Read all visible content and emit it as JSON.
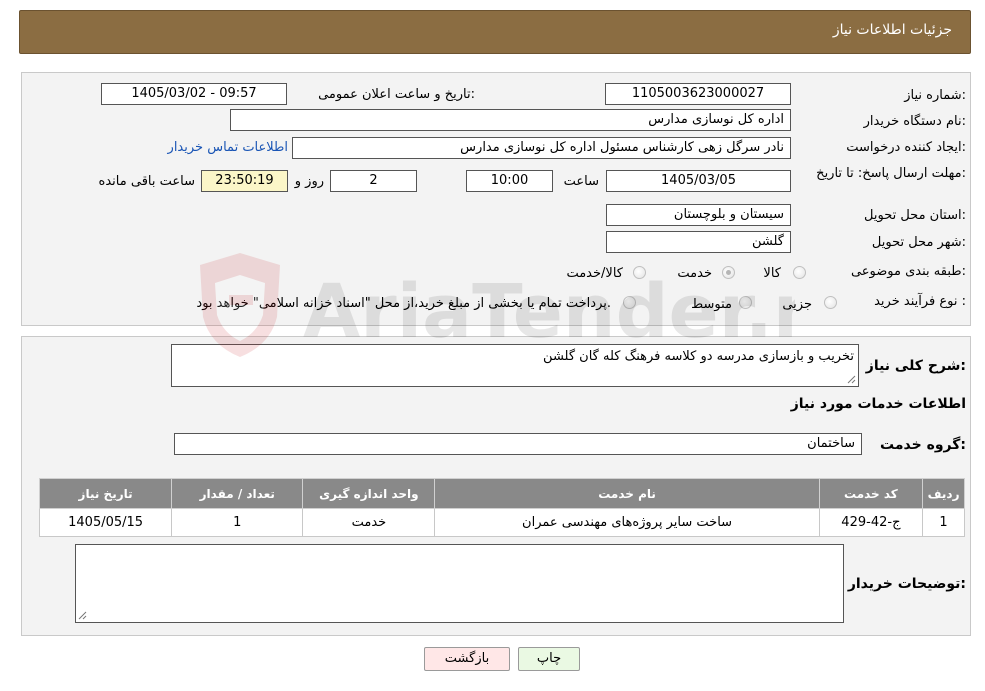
{
  "header": {
    "title": "جزئیات اطلاعات نیاز"
  },
  "form": {
    "need_number_label": "شماره نیاز:",
    "need_number": "1105003623000027",
    "announce_label": "تاریخ و ساعت اعلان عمومی:",
    "announce_value": "1405/03/02 - 09:57",
    "buyer_org_label": "نام دستگاه خریدار:",
    "buyer_org": "اداره کل نوسازی مدارس",
    "creator_label": "ایجاد کننده درخواست:",
    "creator": "نادر سرگل زهی کارشناس مسئول اداره کل نوسازی مدارس",
    "contact_link": "اطلاعات تماس خریدار",
    "deadline_label": "مهلت ارسال پاسخ: تا تاریخ:",
    "deadline_date": "1405/03/05",
    "hour_label": "ساعت",
    "deadline_time": "10:00",
    "days_value": "2",
    "days_label": "روز و",
    "remaining_time": "23:50:19",
    "remaining_label": "ساعت باقی مانده",
    "province_label": "استان محل تحویل:",
    "province": "سیستان و بلوچستان",
    "city_label": "شهر محل تحویل:",
    "city": "گلشن",
    "category_label": "طبقه بندی موضوعی:",
    "category_options": [
      "کالا",
      "خدمت",
      "کالا/خدمت"
    ],
    "category_selected_index": 1,
    "process_label": "نوع فرآیند خرید :",
    "process_options": [
      "جزیی",
      "متوسط"
    ],
    "process_note": "پرداخت تمام یا بخشی از مبلغ خرید،از محل \"اسناد خزانه اسلامی\" خواهد بود."
  },
  "details": {
    "summary_label": "شرح کلی نیاز:",
    "summary": "تخریب و بازسازی مدرسه دو کلاسه فرهنگ کله گان گلشن",
    "services_title": "اطلاعات خدمات مورد نیاز",
    "service_group_label": "گروه خدمت:",
    "service_group": "ساختمان",
    "table_headers": [
      "ردیف",
      "کد خدمت",
      "نام خدمت",
      "واحد اندازه گیری",
      "تعداد / مقدار",
      "تاریخ نیاز"
    ],
    "table_rows": [
      [
        "1",
        "ج-42-429",
        "ساخت سایر پروژه‌های مهندسی عمران",
        "خدمت",
        "1",
        "1405/05/15"
      ]
    ],
    "buyer_notes_label": "توضیحات خریدار:",
    "buyer_notes": ""
  },
  "buttons": {
    "print": "چاپ",
    "back": "بازگشت"
  },
  "watermark": {
    "text": "AriaTender.neT"
  }
}
